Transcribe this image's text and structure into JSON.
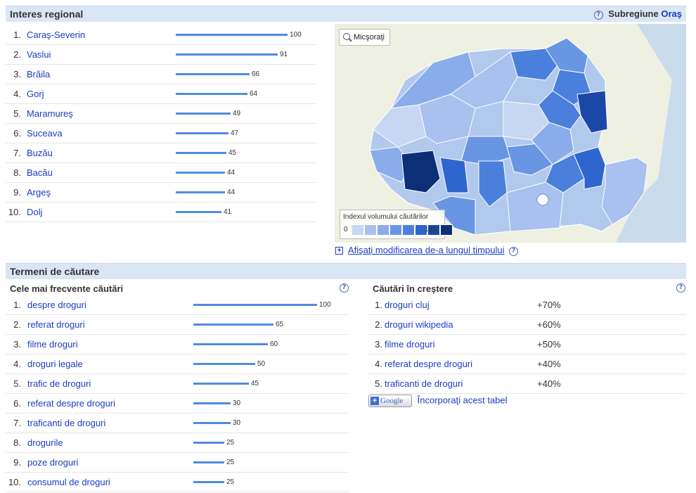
{
  "regional": {
    "title": "Interes regional",
    "subregion_label": "Subregiune",
    "subregion_link": "Oraş",
    "help": "?",
    "rows": [
      {
        "rank": "1.",
        "name": "Caraş-Severin",
        "value": 100
      },
      {
        "rank": "2.",
        "name": "Vaslui",
        "value": 91
      },
      {
        "rank": "3.",
        "name": "Brăila",
        "value": 66
      },
      {
        "rank": "4.",
        "name": "Gorj",
        "value": 64
      },
      {
        "rank": "5.",
        "name": "Maramureş",
        "value": 49
      },
      {
        "rank": "6.",
        "name": "Suceava",
        "value": 47
      },
      {
        "rank": "7.",
        "name": "Buzău",
        "value": 45
      },
      {
        "rank": "8.",
        "name": "Bacău",
        "value": 44
      },
      {
        "rank": "9.",
        "name": "Argeş",
        "value": 44
      },
      {
        "rank": "10.",
        "name": "Dolj",
        "value": 41
      }
    ]
  },
  "map": {
    "zoom_label": "Micşoraţi",
    "legend_title": "Indexul volumului căutărilor",
    "legend_min": "0",
    "legend_max": "100",
    "legend_colors": [
      "#c6d6f3",
      "#a8c1ee",
      "#8aacea",
      "#6996e3",
      "#4b7fdc",
      "#2f65cf",
      "#1a48a6",
      "#0c2f78"
    ],
    "timeline_link": "Afişaţi modificarea de-a lungul timpului",
    "plus": "+",
    "help": "?"
  },
  "terms": {
    "title": "Termeni de căutare",
    "top_label": "Cele mai frecvente căutări",
    "rising_label": "Căutări în creştere",
    "help": "?",
    "top": [
      {
        "rank": "1.",
        "name": "despre droguri",
        "value": 100
      },
      {
        "rank": "2.",
        "name": "referat droguri",
        "value": 65
      },
      {
        "rank": "3.",
        "name": "filme droguri",
        "value": 60
      },
      {
        "rank": "4.",
        "name": "droguri legale",
        "value": 50
      },
      {
        "rank": "5.",
        "name": "trafic de droguri",
        "value": 45
      },
      {
        "rank": "6.",
        "name": "referat despre droguri",
        "value": 30
      },
      {
        "rank": "7.",
        "name": "traficanti de droguri",
        "value": 30
      },
      {
        "rank": "8.",
        "name": "drogurile",
        "value": 25
      },
      {
        "rank": "9.",
        "name": "poze droguri",
        "value": 25
      },
      {
        "rank": "10.",
        "name": "consumul de droguri",
        "value": 25
      }
    ],
    "rising": [
      {
        "rank": "1.",
        "name": "droguri cluj",
        "change": "+70%"
      },
      {
        "rank": "2.",
        "name": "droguri wikipedia",
        "change": "+60%"
      },
      {
        "rank": "3.",
        "name": "filme droguri",
        "change": "+50%"
      },
      {
        "rank": "4.",
        "name": "referat despre droguri",
        "change": "+40%"
      },
      {
        "rank": "5.",
        "name": "traficanti de droguri",
        "change": "+40%"
      }
    ],
    "embed_button_text": "Google",
    "embed_button_plus": "+",
    "embed_link": "Încorporaţi acest tabel"
  }
}
